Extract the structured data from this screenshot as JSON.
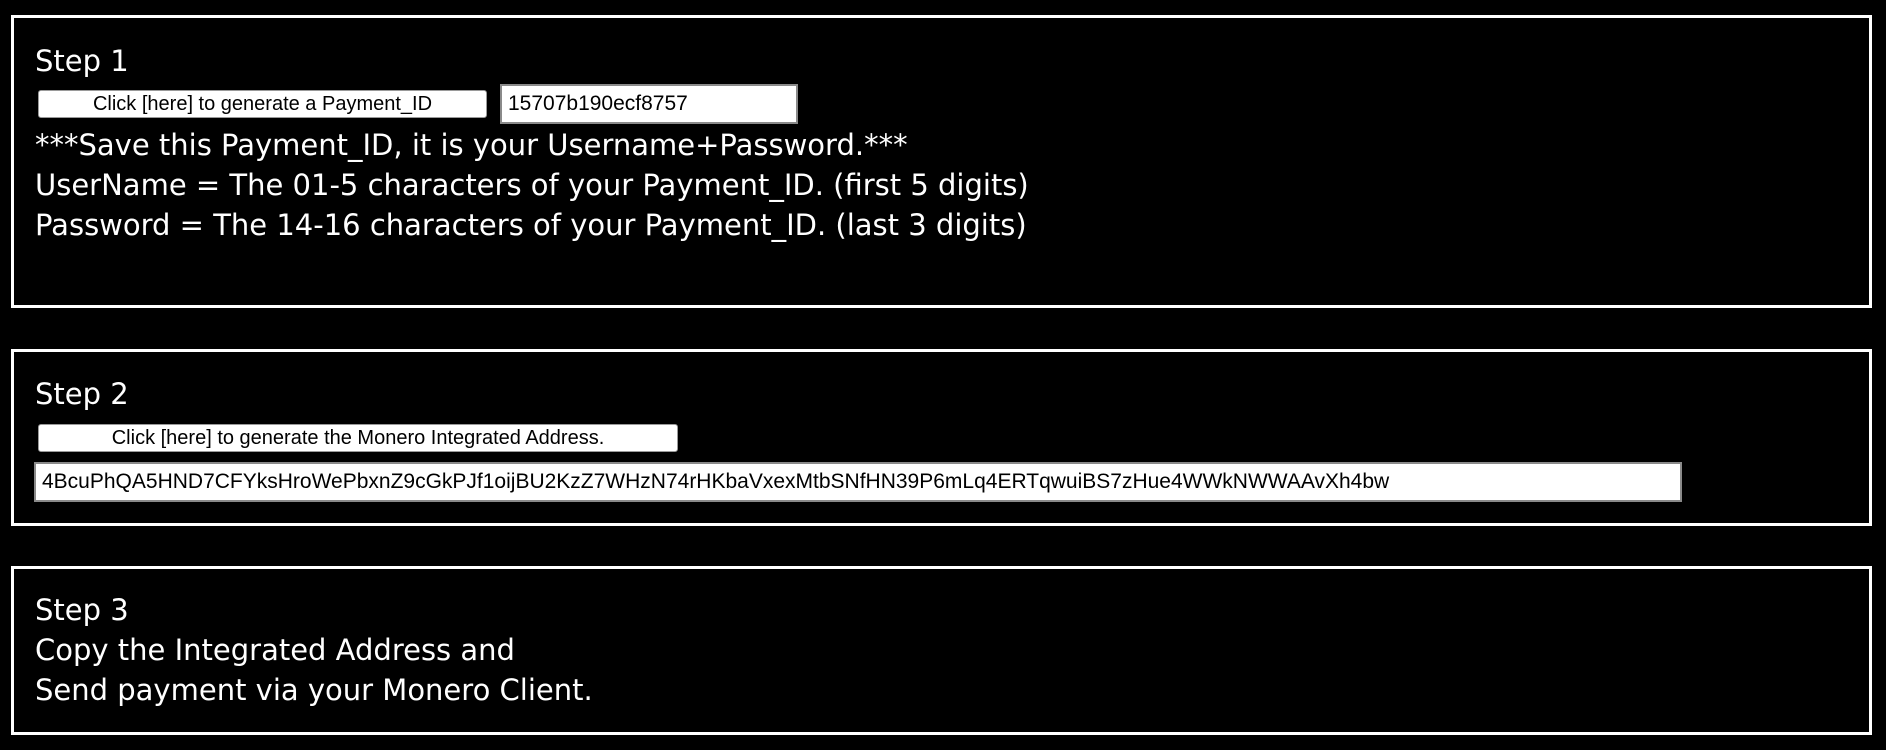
{
  "step1": {
    "heading": "Step 1",
    "button_label": "Click [here] to generate a Payment_ID",
    "payment_id": "15707b190ecf8757",
    "note_save": "***Save this Payment_ID, it is your Username+Password.***",
    "note_username": "UserName = The 01-5 characters of your Payment_ID. (first 5 digits)",
    "note_password": "Password = The 14-16 characters of your Payment_ID. (last 3 digits)"
  },
  "step2": {
    "heading": "Step 2",
    "button_label": "Click [here] to generate the Monero Integrated Address.",
    "integrated_address": "4BcuPhQA5HND7CFYksHroWePbxnZ9cGkPJf1oijBU2KzZ7WHzN74rHKbaVxexMtbSNfHN39P6mLq4ERTqwuiBS7zHue4WWkNWWAAvXh4bw"
  },
  "step3": {
    "heading": "Step 3",
    "line1": "Copy the Integrated Address and",
    "line2": "Send payment via your Monero Client."
  },
  "colors": {
    "background": "#000000",
    "foreground": "#ffffff",
    "field_border": "#8a8a8a"
  }
}
